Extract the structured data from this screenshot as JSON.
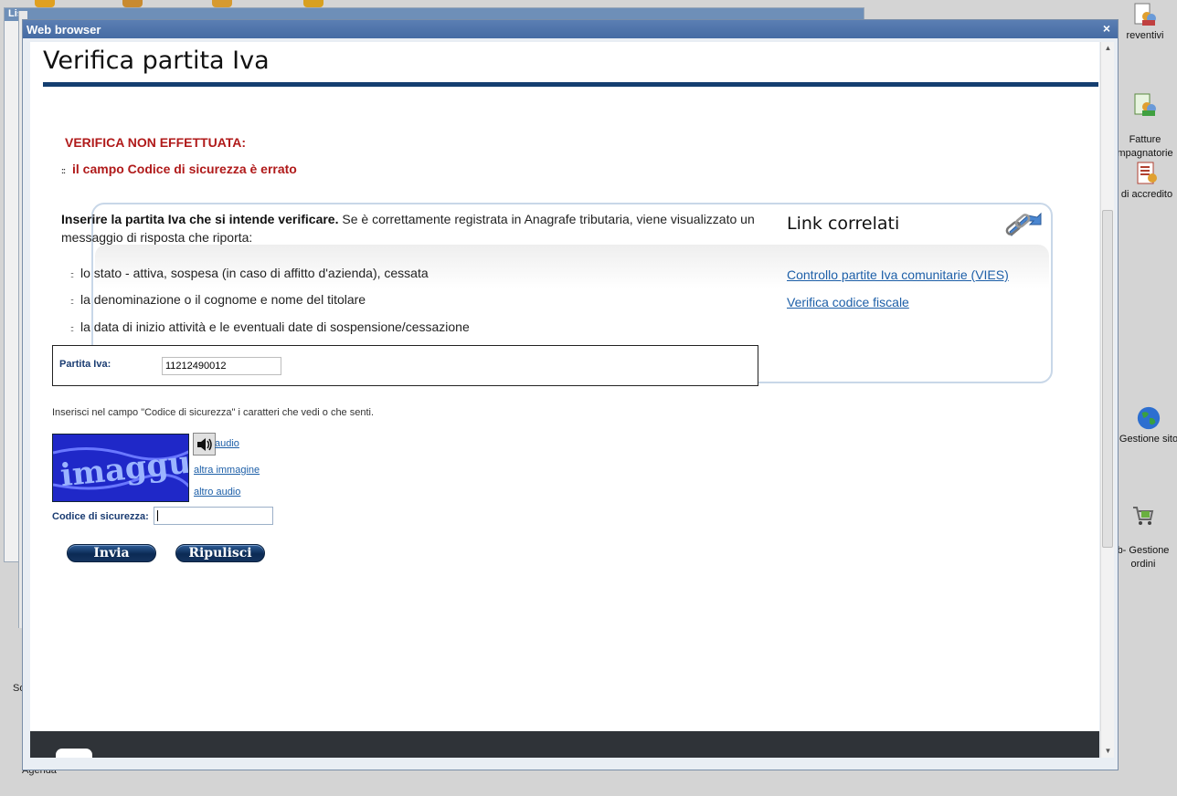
{
  "background": {
    "window_title_partial": "Lis",
    "text_partial_s": "So",
    "text_agenda": "Agenda"
  },
  "desktop_icons": [
    {
      "label": "reventivi",
      "icon": "people-document-icon"
    },
    {
      "label": "Fatture\nmpagnatorie",
      "icon": "people-document-icon"
    },
    {
      "label": "di accredito",
      "icon": "document-list-icon"
    },
    {
      "label": "Gestione sito",
      "icon": "globe-icon"
    },
    {
      "label": "b- Gestione\nordini",
      "icon": "cart-icon"
    }
  ],
  "popup": {
    "title": "Web browser",
    "close": "×"
  },
  "page": {
    "title": "Verifica partita Iva",
    "error_heading": "VERIFICA NON EFFETTUATA:",
    "error_item": "il campo Codice di sicurezza è errato",
    "intro_bold": "Inserire la partita Iva che si intende verificare.",
    "intro_rest": " Se è correttamente registrata in Anagrafe tributaria, viene visualizzato un messaggio di risposta che riporta:",
    "list": [
      "lo stato - attiva, sospesa (in caso di affitto d'azienda), cessata",
      "la denominazione o il cognome e nome del titolare",
      "la data di inizio attività e le eventuali date di sospensione/cessazione"
    ],
    "piva_label": "Partita Iva:",
    "piva_value": "11212490012",
    "captcha_note": "Inserisci nel campo \"Codice di sicurezza\" i caratteri che vedi o che senti.",
    "captcha_text": "imaggu",
    "audio_link": " audio",
    "other_image_link": "altra immagine",
    "other_audio_link": "altro audio",
    "code_label": "Codice di sicurezza:",
    "code_value": "",
    "submit": "Invia",
    "reset": "Ripulisci"
  },
  "related": {
    "title": "Link correlati",
    "links": [
      "Controllo partite Iva comunitarie (VIES)",
      "Verifica codice fiscale"
    ]
  },
  "colors": {
    "error": "#b01a1a",
    "link": "#1d5fa8",
    "rule": "#143e70",
    "button": "#0b2a54"
  }
}
